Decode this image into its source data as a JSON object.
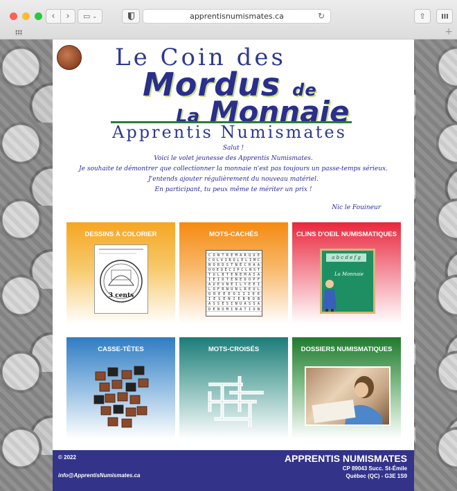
{
  "browser": {
    "url": "apprentisnumismates.ca",
    "icons": [
      "back-icon",
      "forward-icon",
      "sidebar-icon",
      "shield-icon",
      "reload-icon",
      "share-icon",
      "tabs-icon",
      "apps-icon",
      "plus-icon"
    ]
  },
  "header": {
    "line1": "Le Coin des",
    "line2_main": "Mordus",
    "line2_de": "de",
    "line3_la": "La",
    "line3_main": "Monnaie",
    "line4": "Apprentis Numismates"
  },
  "intro": {
    "lines": [
      "Salut !",
      "Voici le volet jeunesse des Apprentis Numismates.",
      "Je souhaite te démontrer que collectionner la monnaie n'est pas toujours un passe-temps sérieux.",
      "J'entends ajouter régulièrement du nouveau matériel.",
      "En participant, tu peux même te mériter un prix !"
    ],
    "signature": "Nic le Fouineur"
  },
  "tiles": [
    {
      "title": "DESSINS À COLORIER",
      "image_caption": "3 cents",
      "accent": "#f5a623"
    },
    {
      "title": "MOTS-CACHÉS",
      "accent": "#f58a10"
    },
    {
      "title": "CLINS D'OEIL NUMISMATIQUES",
      "board_text": "La Monnaie",
      "accent": "#e8283c"
    },
    {
      "title": "CASSE-TÊTES",
      "accent": "#2f7cc2"
    },
    {
      "title": "MOTS-CROISÉS",
      "accent": "#1c7c78"
    },
    {
      "title": "DOSSIERS NUMISMATIQUES",
      "accent": "#1f7a2e"
    }
  ],
  "footer": {
    "copyright": "© 2022",
    "email": "info@ApprentisNumismates.ca",
    "org": "APPRENTIS NUMISMATES",
    "address1": "CP 89043  Succ. St-Émile",
    "address2": "Québec (QC)  - G3E 1S9"
  }
}
